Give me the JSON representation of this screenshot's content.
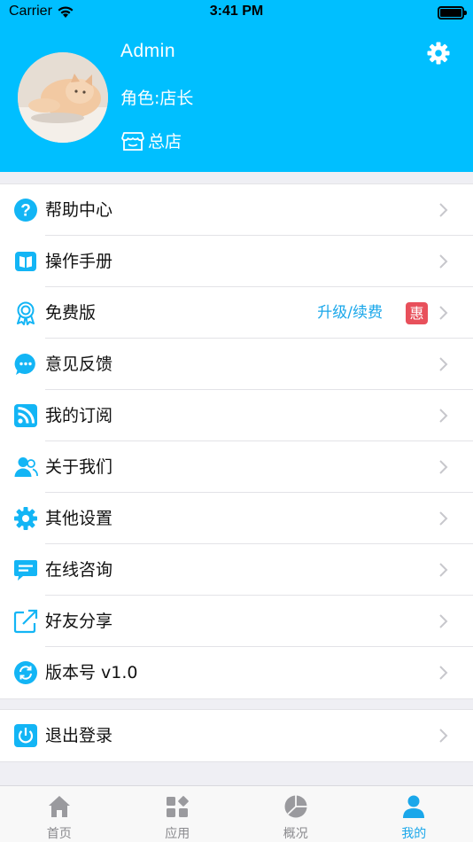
{
  "status_bar": {
    "carrier": "Carrier",
    "time": "3:41 PM"
  },
  "profile": {
    "name": "Admin",
    "role": "角色:店长",
    "store": "总店"
  },
  "colors": {
    "header_bg": "#00bfff",
    "accent": "#1aa7ea",
    "icon_blue": "#13b5f5",
    "promo_badge": "#e8505b"
  },
  "menu": [
    {
      "label": "帮助中心",
      "icon": "help-icon"
    },
    {
      "label": "操作手册",
      "icon": "book-icon"
    },
    {
      "label": "免费版",
      "icon": "award-icon",
      "action": "升级/续费",
      "badge": "惠"
    },
    {
      "label": "意见反馈",
      "icon": "feedback-icon"
    },
    {
      "label": "我的订阅",
      "icon": "rss-icon"
    },
    {
      "label": "关于我们",
      "icon": "users-icon"
    },
    {
      "label": "其他设置",
      "icon": "gear-icon"
    },
    {
      "label": "在线咨询",
      "icon": "chat-icon"
    },
    {
      "label": "好友分享",
      "icon": "share-icon"
    },
    {
      "label": "版本号 v1.0",
      "icon": "refresh-icon"
    }
  ],
  "logout": {
    "label": "退出登录",
    "icon": "power-icon"
  },
  "tabbar": [
    {
      "label": "首页",
      "icon": "home-icon",
      "active": false
    },
    {
      "label": "应用",
      "icon": "apps-icon",
      "active": false
    },
    {
      "label": "概况",
      "icon": "pie-chart-icon",
      "active": false
    },
    {
      "label": "我的",
      "icon": "user-icon",
      "active": true
    }
  ]
}
